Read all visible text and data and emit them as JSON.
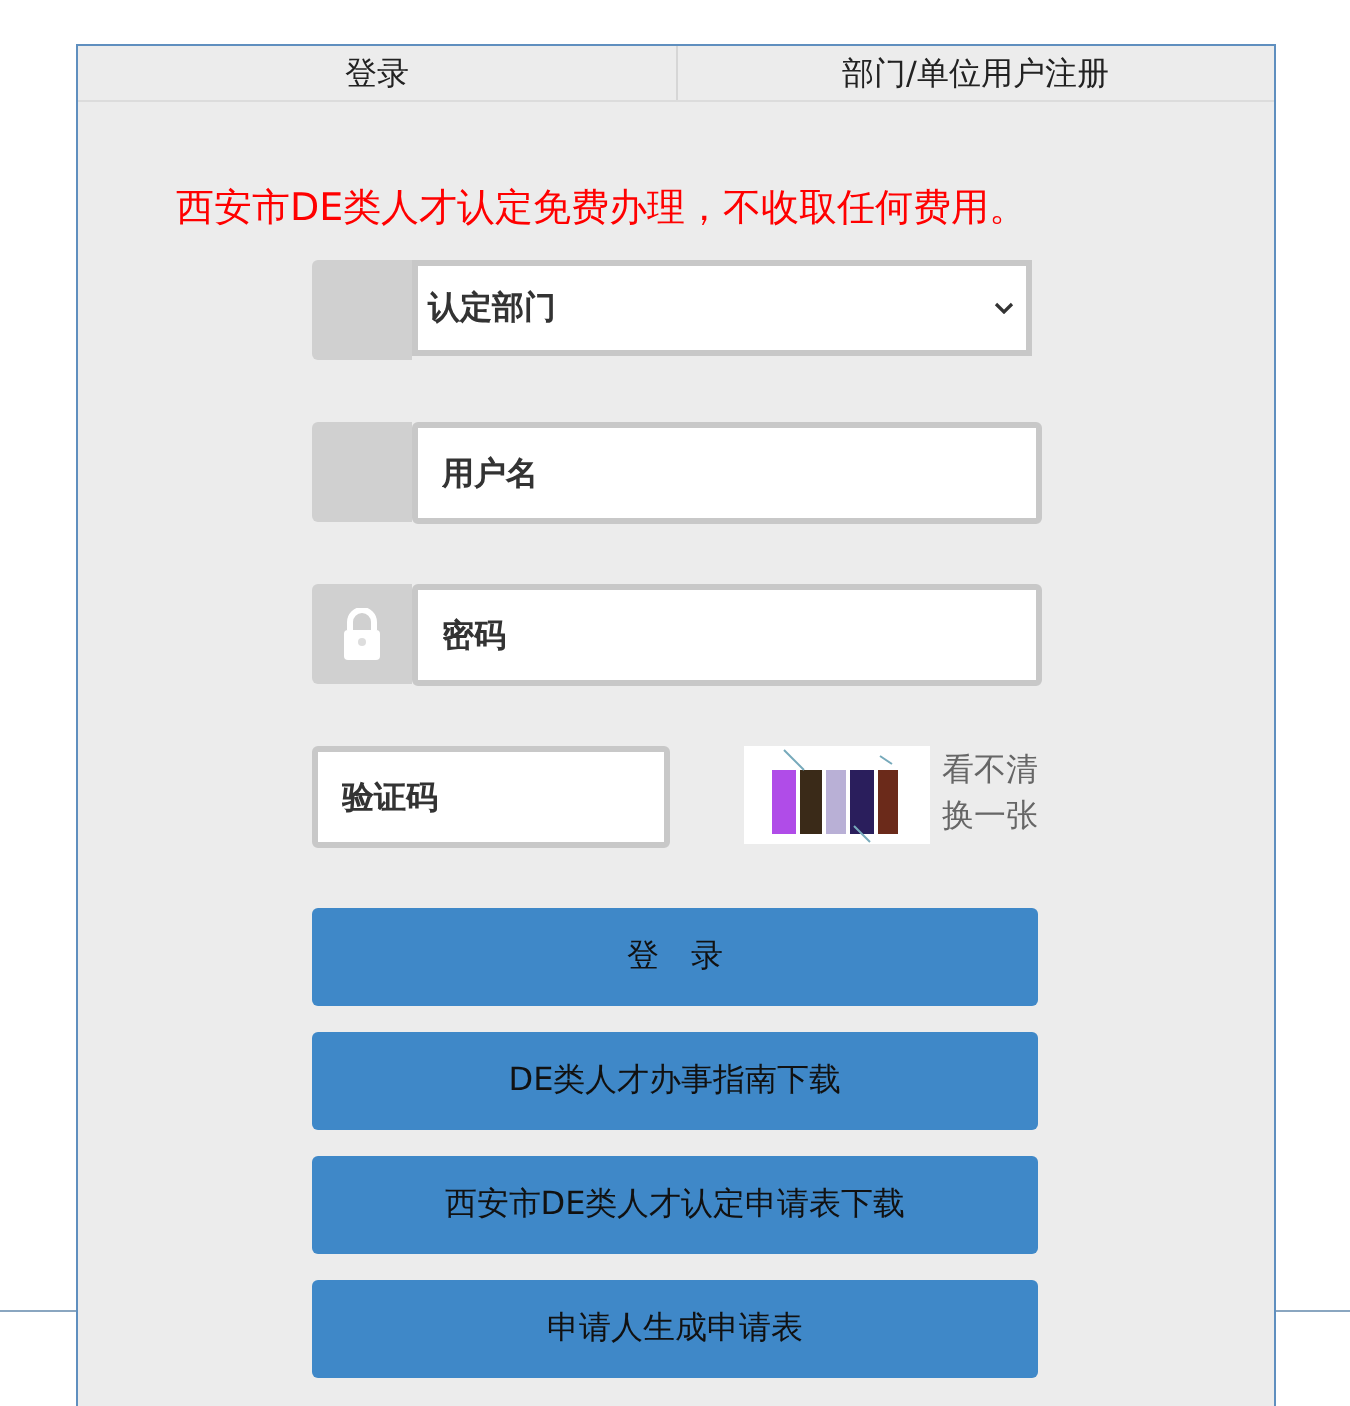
{
  "tabs": [
    {
      "label": "登录"
    },
    {
      "label": "部门/单位用户注册"
    }
  ],
  "notice": "西安市DE类人才认定免费办理，不收取任何费用。",
  "form": {
    "department": {
      "value": "认定部门"
    },
    "username": {
      "placeholder": "用户名"
    },
    "password": {
      "placeholder": "密码"
    },
    "captcha": {
      "placeholder": "验证码",
      "refresh_line_1": "看不清",
      "refresh_line_2": "换一张"
    }
  },
  "buttons": [
    "登　录",
    "DE类人才办事指南下载",
    "西安市DE类人才认定申请表下载",
    "申请人生成申请表"
  ]
}
